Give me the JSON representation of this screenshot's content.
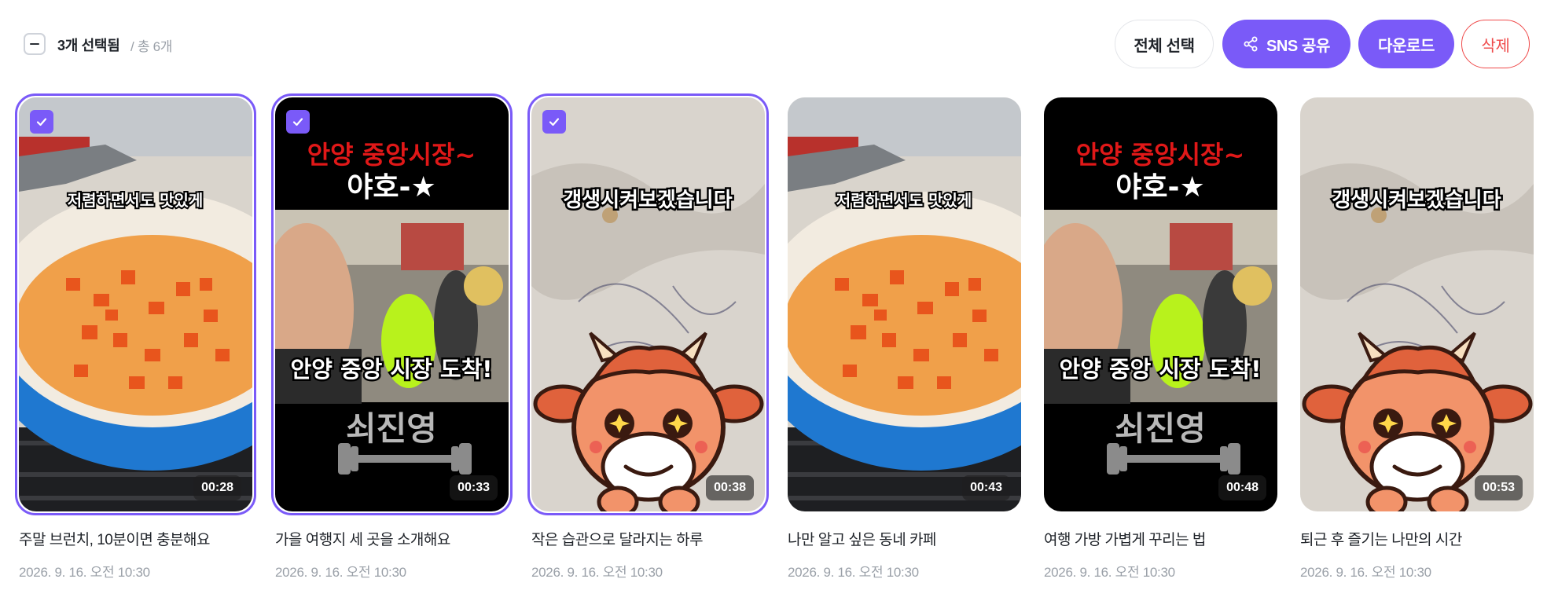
{
  "toolbar": {
    "selected_label": "3개 선택됨",
    "total_label": "/ 총 6개",
    "select_all": "전체 선택",
    "share": "SNS 공유",
    "download": "다운로드",
    "delete": "삭제"
  },
  "colors": {
    "accent": "#7a5af8",
    "danger": "#ef4a4a",
    "muted": "#9aa0a8"
  },
  "videos": [
    {
      "title": "주말 브런치, 10분이면 충분해요",
      "date": "2026. 9. 16. 오전 10:30",
      "duration": "00:28",
      "selected": true,
      "thumbnail": "cooking",
      "caption": "저렴하면서도 맛있게"
    },
    {
      "title": "가을 여행지 세 곳을 소개해요",
      "date": "2026. 9. 16. 오전 10:30",
      "duration": "00:33",
      "selected": true,
      "thumbnail": "market",
      "caption_top_1": "안양 중앙시장~",
      "caption_top_2": "야호-★",
      "caption_mid": "안양 중앙 시장 도착!",
      "caption_bottom": "쇠진영"
    },
    {
      "title": "작은 습관으로 달라지는 하루",
      "date": "2026. 9. 16. 오전 10:30",
      "duration": "00:38",
      "selected": true,
      "thumbnail": "cow",
      "caption": "갱생시켜보겠습니다"
    },
    {
      "title": "나만 알고 싶은 동네 카페",
      "date": "2026. 9. 16. 오전 10:30",
      "duration": "00:43",
      "selected": false,
      "thumbnail": "cooking",
      "caption": "저렴하면서도 맛있게"
    },
    {
      "title": "여행 가방 가볍게 꾸리는 법",
      "date": "2026. 9. 16. 오전 10:30",
      "duration": "00:48",
      "selected": false,
      "thumbnail": "market",
      "caption_top_1": "안양 중앙시장~",
      "caption_top_2": "야호-★",
      "caption_mid": "안양 중앙 시장 도착!",
      "caption_bottom": "쇠진영"
    },
    {
      "title": "퇴근 후 즐기는 나만의 시간",
      "date": "2026. 9. 16. 오전 10:30",
      "duration": "00:53",
      "selected": false,
      "thumbnail": "cow",
      "caption": "갱생시켜보겠습니다"
    }
  ]
}
